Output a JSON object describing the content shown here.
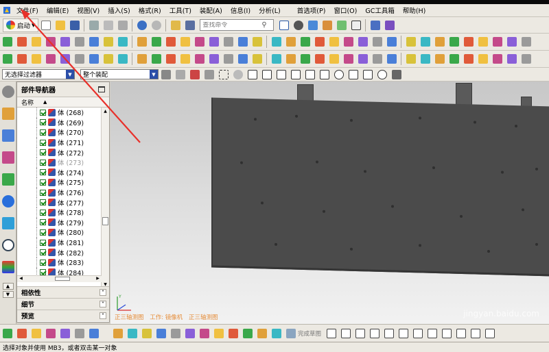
{
  "menu": {
    "items": [
      "文件(F)",
      "编辑(E)",
      "视图(V)",
      "插入(S)",
      "格式(R)",
      "工具(T)",
      "装配(A)",
      "信息(I)",
      "分析(L)",
      "首选项(P)",
      "窗口(O)",
      "GC工具箱",
      "帮助(H)"
    ]
  },
  "toolbar": {
    "launch_label": "启动",
    "search_placeholder": "查找命令"
  },
  "filter": {
    "selection_filter": "无选择过滤器",
    "scope": "整个装配"
  },
  "navigator": {
    "title": "部件导航器",
    "column_name": "名称",
    "rows": [
      {
        "label": "体 (268)",
        "dim": false
      },
      {
        "label": "体 (269)",
        "dim": false
      },
      {
        "label": "体 (270)",
        "dim": false
      },
      {
        "label": "体 (271)",
        "dim": false
      },
      {
        "label": "体 (272)",
        "dim": false
      },
      {
        "label": "体 (273)",
        "dim": true
      },
      {
        "label": "体 (274)",
        "dim": false
      },
      {
        "label": "体 (275)",
        "dim": false
      },
      {
        "label": "体 (276)",
        "dim": false
      },
      {
        "label": "体 (277)",
        "dim": false
      },
      {
        "label": "体 (278)",
        "dim": false
      },
      {
        "label": "体 (279)",
        "dim": false
      },
      {
        "label": "体 (280)",
        "dim": false
      },
      {
        "label": "体 (281)",
        "dim": false
      },
      {
        "label": "体 (282)",
        "dim": false
      },
      {
        "label": "体 (283)",
        "dim": false
      },
      {
        "label": "体 (284)",
        "dim": false
      }
    ],
    "sections": [
      "相依性",
      "细节",
      "预览"
    ]
  },
  "viewport": {
    "view_labels": [
      "正三轴测图",
      "工作: 镜像机",
      "正三轴测图"
    ],
    "watermark": "jingyan.baidu.com",
    "model_color": "#4b4b4b",
    "annotation_color": "#e8302a"
  },
  "bottom_toolbar": {
    "finish_sketch": "完成草图"
  },
  "status": {
    "prompt": "选择对象并使用 MB3，或者双击某一对象"
  }
}
